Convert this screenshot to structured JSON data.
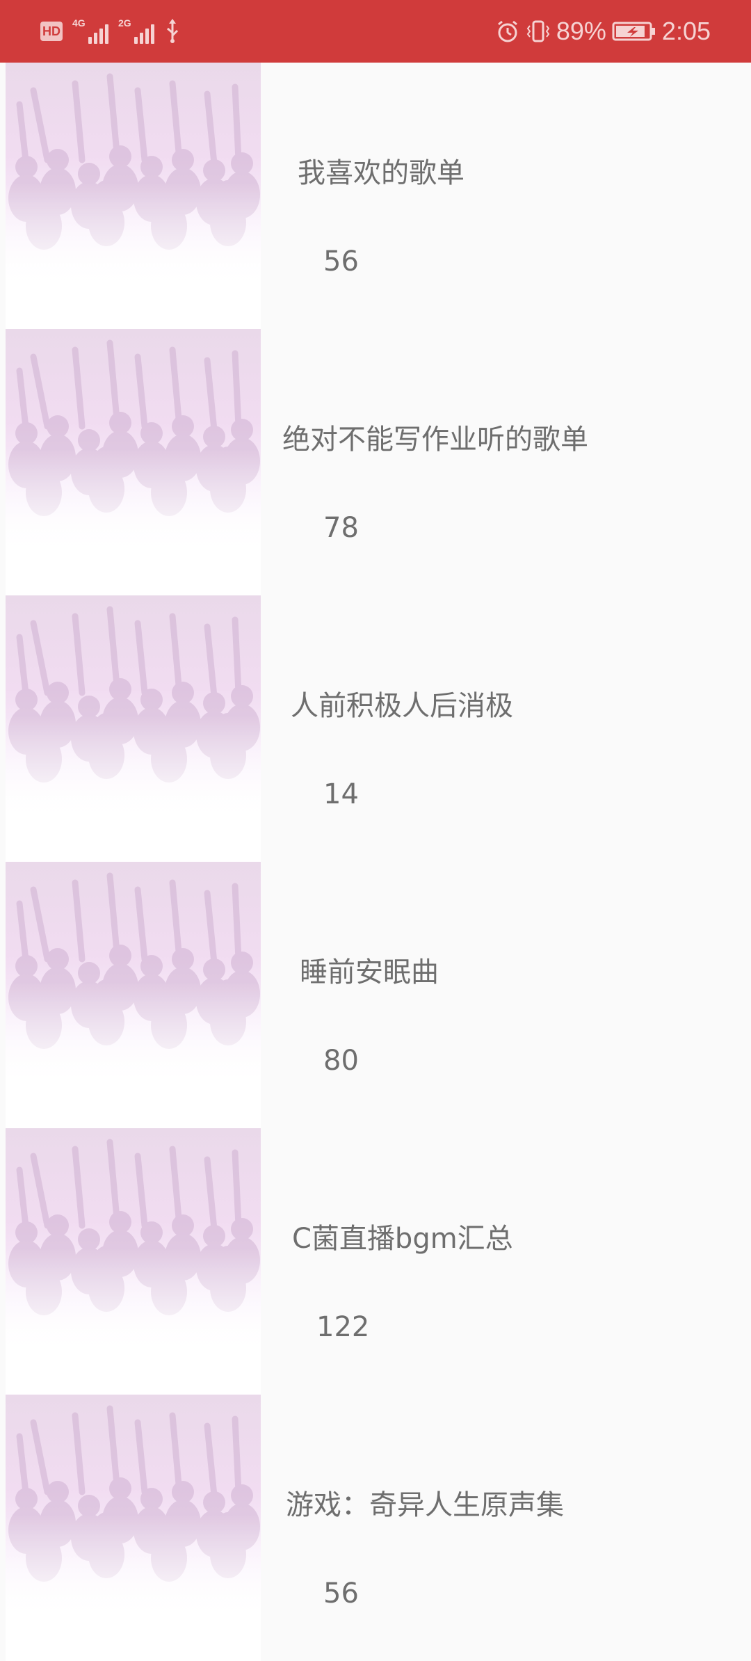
{
  "status_bar": {
    "hd_label": "HD",
    "network_1": "4G",
    "network_2": "2G",
    "battery_percent": "89%",
    "time": "2:05",
    "battery_level": 0.89,
    "icons": [
      "hd-icon",
      "signal-icon",
      "signal-icon",
      "usb-icon",
      "alarm-icon",
      "vibrate-icon",
      "battery-charging-icon"
    ]
  },
  "playlists": [
    {
      "title": "我喜欢的歌单",
      "count": "56"
    },
    {
      "title": "绝对不能写作业听的歌单",
      "count": "78"
    },
    {
      "title": "人前积极人后消极",
      "count": "14"
    },
    {
      "title": "睡前安眠曲",
      "count": "80"
    },
    {
      "title": "C菌直播bgm汇总",
      "count": "122"
    },
    {
      "title": "游戏：奇异人生原声集",
      "count": "56"
    }
  ],
  "colors": {
    "status_bar_bg": "#d03b3b",
    "page_bg": "#fafafa",
    "text": "#6e6e6e"
  }
}
